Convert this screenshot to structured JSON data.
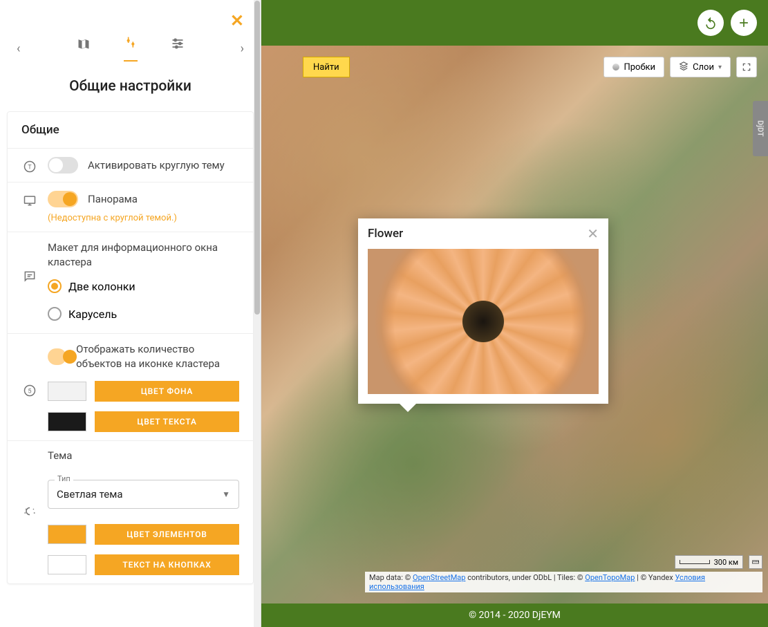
{
  "sidebar": {
    "close": "✕",
    "title": "Общие настройки",
    "tabs": {
      "prev": "‹",
      "next": "›"
    },
    "card": {
      "header": "Общие",
      "round_theme": {
        "label": "Активировать круглую тему",
        "on": false
      },
      "panorama": {
        "label": "Панорама",
        "sub": "(Недоступна с круглой темой.)",
        "on": true
      },
      "cluster_layout": {
        "label": "Макет для информационного окна кластера",
        "options": [
          {
            "label": "Две колонки",
            "checked": true
          },
          {
            "label": "Карусель",
            "checked": false
          }
        ]
      },
      "cluster_count": {
        "label": "Отображать количество объектов на иконке кластера",
        "on": true
      },
      "bg_color": {
        "swatch": "#f2f2f2",
        "btn": "ЦВЕТ ФОНА"
      },
      "text_color": {
        "swatch": "#1a1a1a",
        "btn": "ЦВЕТ ТЕКСТА"
      },
      "theme": {
        "heading": "Тема",
        "type_label": "Тип",
        "selected": "Светлая тема",
        "elements_swatch": "#f5a623",
        "elements_btn": "ЦВЕТ ЭЛЕМЕНТОВ",
        "text_btn_swatch": "#ffffff",
        "text_btn_btn": "ТЕКСТ НА КНОПКАХ"
      }
    }
  },
  "header": {},
  "map": {
    "find": "Найти",
    "traffic": "Пробки",
    "layers": "Слои",
    "side_tag": "DjDT",
    "balloon": {
      "title": "Flower"
    },
    "scale": "300 км",
    "attribution": {
      "prefix": "Map data: © ",
      "osm": "OpenStreetMap",
      "mid": " contributors, under ODbL | Tiles: © ",
      "otm": "OpenTopoMap",
      "yandex_prefix": " | © Yandex ",
      "yandex_terms": "Условия использования"
    }
  },
  "footer": "© 2014 - 2020 DjEYM"
}
